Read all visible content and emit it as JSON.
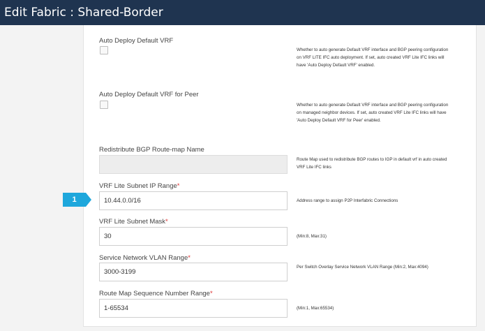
{
  "title": "Edit Fabric : Shared-Border",
  "fields": {
    "auto_deploy_default_vrf": {
      "label": "Auto Deploy Default VRF",
      "checked": false,
      "description": "Whether to auto generate Default VRF interface and BGP peering configuration on VRF LITE IFC auto deployment. If set, auto created VRF Lite IFC links will have 'Auto Deploy Default VRF' enabled."
    },
    "auto_deploy_default_vrf_peer": {
      "label": "Auto Deploy Default VRF for Peer",
      "checked": false,
      "description": "Whether to auto generate Default VRF interface and BGP peering configuration on managed neighbor devices. If set, auto created VRF Lite IFC links will have 'Auto Deploy Default VRF for Peer' enabled."
    },
    "redistribute_route_map": {
      "label": "Redistribute BGP Route-map Name",
      "value": "",
      "description": "Route Map used to redistribute BGP routes to IGP in default vrf in auto created VRF Lite IFC links"
    },
    "vrf_lite_subnet_range": {
      "label": "VRF Lite Subnet IP Range",
      "required_mark": "*",
      "value": "10.44.0.0/16",
      "description": "Address range to assign P2P Interfabric Connections"
    },
    "vrf_lite_subnet_mask": {
      "label": "VRF Lite Subnet Mask",
      "required_mark": "*",
      "value": "30",
      "description": "(Min:8, Max:31)"
    },
    "service_network_vlan_range": {
      "label": "Service Network VLAN Range",
      "required_mark": "*",
      "value": "3000-3199",
      "description": "Per Switch Overlay Service Network VLAN Range (Min:2, Max:4094)"
    },
    "route_map_seq_range": {
      "label": "Route Map Sequence Number Range",
      "required_mark": "*",
      "value": "1-65534",
      "description": "(Min:1, Max:65534)"
    }
  },
  "callout": {
    "number": "1",
    "color": "#1ea7dc"
  },
  "colors": {
    "title_bar": "#1f3450",
    "required": "#dd3333"
  }
}
